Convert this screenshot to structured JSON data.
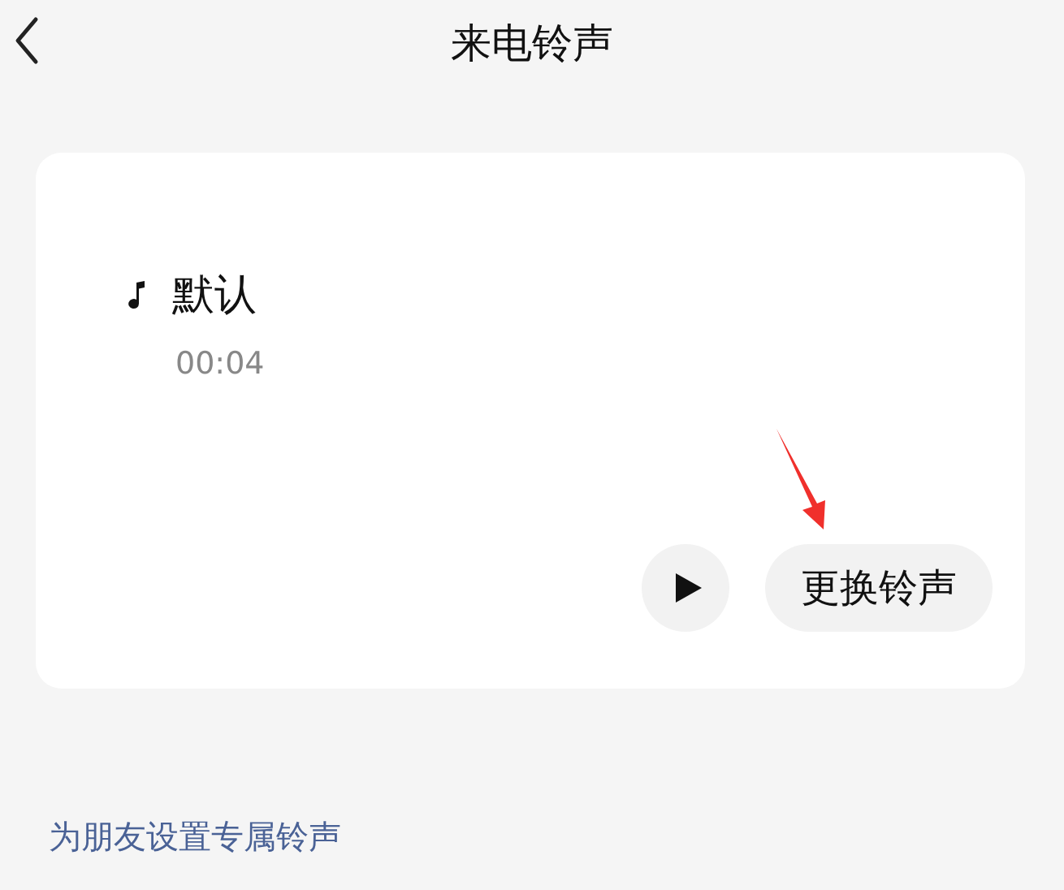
{
  "header": {
    "title": "来电铃声"
  },
  "ringtone": {
    "name": "默认",
    "duration": "00:04",
    "change_label": "更换铃声"
  },
  "friend_link": "为朋友设置专属铃声"
}
